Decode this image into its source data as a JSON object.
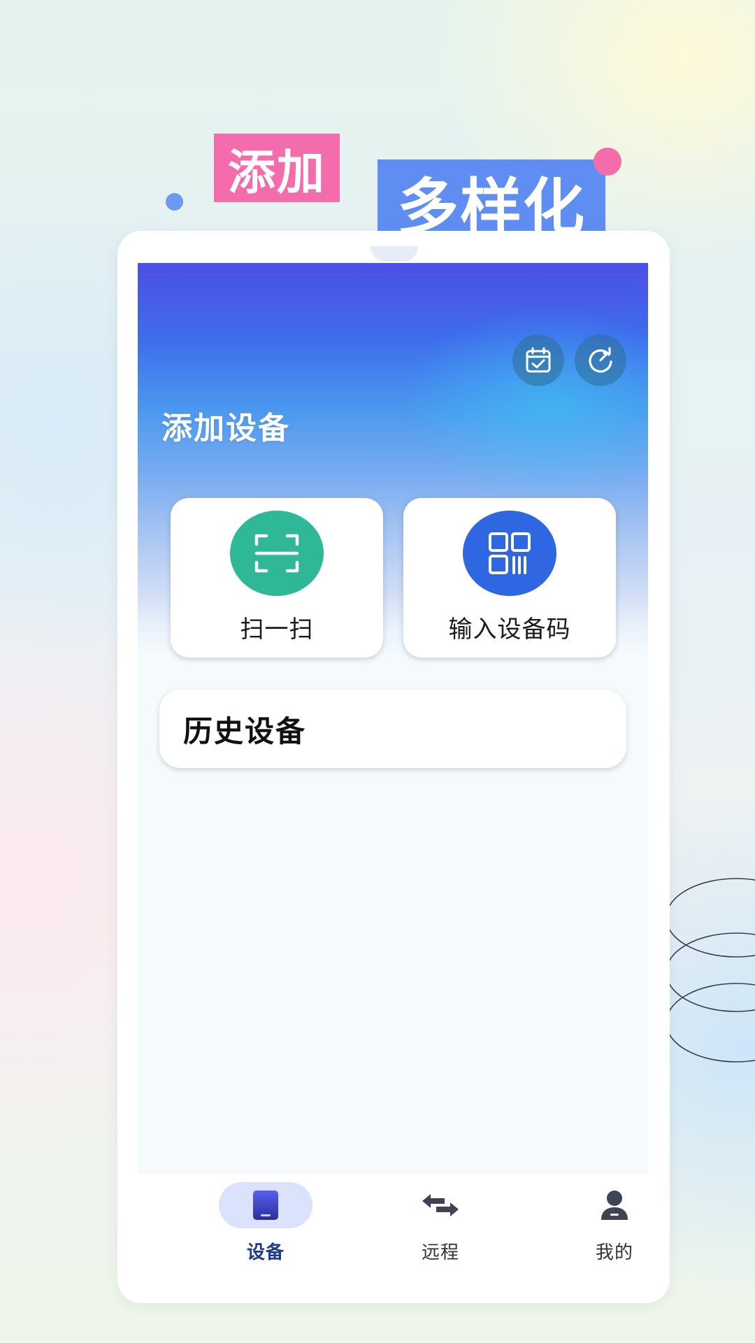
{
  "promo": {
    "word_add": "添加",
    "word_diverse": "多样化"
  },
  "colors": {
    "promo_pink": "#f46cab",
    "promo_blue": "#5f8df2",
    "scan_green": "#2fb898",
    "code_blue": "#2f66e2",
    "nav_active": "#1d3b8a"
  },
  "header": {
    "icons": [
      "calendar-check-icon",
      "refresh-icon"
    ]
  },
  "add_device": {
    "title": "添加设备",
    "scan_label": "扫一扫",
    "code_label": "输入设备码"
  },
  "history": {
    "title": "历史设备"
  },
  "nav": {
    "active": "devices",
    "items": [
      {
        "id": "devices",
        "label": "设备",
        "icon": "tablet-icon"
      },
      {
        "id": "remote",
        "label": "远程",
        "icon": "swap-arrows-icon"
      },
      {
        "id": "mine",
        "label": "我的",
        "icon": "person-icon"
      }
    ]
  }
}
